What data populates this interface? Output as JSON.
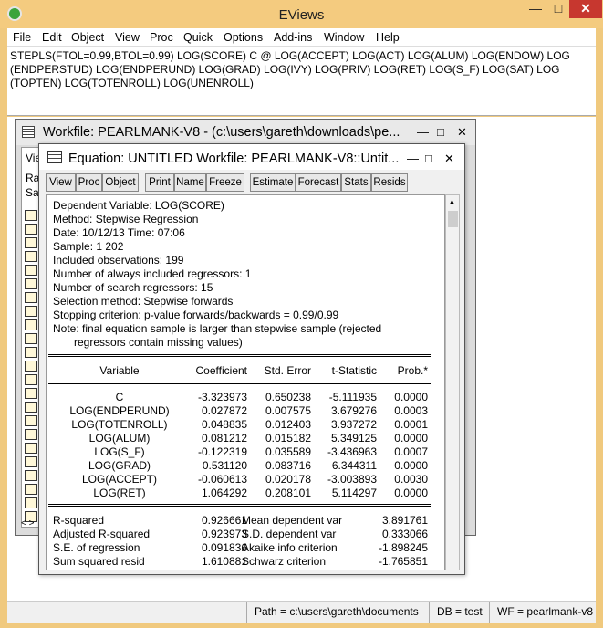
{
  "app": {
    "title": "EViews",
    "menu": [
      "File",
      "Edit",
      "Object",
      "View",
      "Proc",
      "Quick",
      "Options",
      "Add-ins",
      "Window",
      "Help"
    ],
    "command": "STEPLS(FTOL=0.99,BTOL=0.99) LOG(SCORE) C @ LOG(ACCEPT) LOG(ACT) LOG(ALUM) LOG(ENDOW) LOG (ENDPERSTUD) LOG(ENDPERUND) LOG(GRAD) LOG(IVY) LOG(PRIV) LOG(RET) LOG(S_F) LOG(SAT) LOG (TOPTEN) LOG(TOTENROLL) LOG(UNENROLL)"
  },
  "status": {
    "path": "Path = c:\\users\\gareth\\documents",
    "db": "DB = test",
    "wf": "WF = pearlmank-v8"
  },
  "workfile": {
    "title": "Workfile: PEARLMANK-V8 - (c:\\users\\gareth\\downloads\\pe...",
    "left_labels": [
      "Vie",
      "Ra",
      "Sa"
    ]
  },
  "equation": {
    "title": "Equation: UNTITLED   Workfile: PEARLMANK-V8::Untit...",
    "toolbar": [
      "View",
      "Proc",
      "Object",
      "Print",
      "Name",
      "Freeze",
      "Estimate",
      "Forecast",
      "Stats",
      "Resids"
    ],
    "header": [
      "Dependent Variable: LOG(SCORE)",
      "Method: Stepwise Regression",
      "Date: 10/12/13   Time: 07:06",
      "Sample: 1 202",
      "Included observations: 199",
      "Number of always included regressors: 1",
      "Number of search regressors: 15",
      "Selection method: Stepwise forwards",
      "Stopping criterion: p-value forwards/backwards = 0.99/0.99",
      "Note: final equation sample is larger than stepwise sample (rejected",
      "      regressors contain missing values)"
    ],
    "columns": [
      "Variable",
      "Coefficient",
      "Std. Error",
      "t-Statistic",
      "Prob.*"
    ],
    "rows": [
      [
        "C",
        "-3.323973",
        "0.650238",
        "-5.111935",
        "0.0000"
      ],
      [
        "LOG(ENDPERUND)",
        "0.027872",
        "0.007575",
        "3.679276",
        "0.0003"
      ],
      [
        "LOG(TOTENROLL)",
        "0.048835",
        "0.012403",
        "3.937272",
        "0.0001"
      ],
      [
        "LOG(ALUM)",
        "0.081212",
        "0.015182",
        "5.349125",
        "0.0000"
      ],
      [
        "LOG(S_F)",
        "-0.122319",
        "0.035589",
        "-3.436963",
        "0.0007"
      ],
      [
        "LOG(GRAD)",
        "0.531120",
        "0.083716",
        "6.344311",
        "0.0000"
      ],
      [
        "LOG(ACCEPT)",
        "-0.060613",
        "0.020178",
        "-3.003893",
        "0.0030"
      ],
      [
        "LOG(RET)",
        "1.064292",
        "0.208101",
        "5.114297",
        "0.0000"
      ]
    ],
    "stats": [
      [
        "R-squared",
        "0.926661",
        "Mean dependent var",
        "3.891761"
      ],
      [
        "Adjusted R-squared",
        "0.923973",
        "S.D. dependent var",
        "0.333066"
      ],
      [
        "S.E. of regression",
        "0.091836",
        "Akaike info criterion",
        "-1.898245"
      ],
      [
        "Sum squared resid",
        "1.610881",
        "Schwarz criterion",
        "-1.765851"
      ]
    ]
  }
}
